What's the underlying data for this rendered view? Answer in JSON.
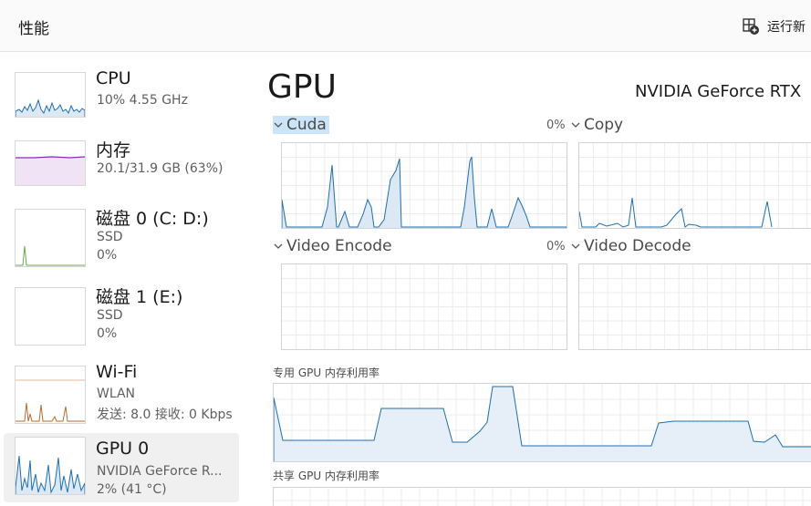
{
  "header": {
    "title": "性能",
    "run_task_label": "运行新"
  },
  "sidebar": {
    "items": [
      {
        "name": "CPU",
        "line1": "10% 4.55 GHz",
        "line2": ""
      },
      {
        "name": "内存",
        "line1": "20.1/31.9 GB (63%)",
        "line2": ""
      },
      {
        "name": "磁盘 0 (C: D:)",
        "line1": "SSD",
        "line2": "0%"
      },
      {
        "name": "磁盘 1 (E:)",
        "line1": "SSD",
        "line2": "0%"
      },
      {
        "name": "Wi-Fi",
        "line1": "WLAN",
        "line2": "发送: 8.0 接收: 0 Kbps"
      },
      {
        "name": "GPU 0",
        "line1": "NVIDIA GeForce R...",
        "line2": "2% (41 °C)"
      }
    ]
  },
  "main": {
    "title": "GPU",
    "model": "NVIDIA GeForce RTX",
    "engines": [
      {
        "label": "Cuda",
        "percent": "0%"
      },
      {
        "label": "Copy",
        "percent": ""
      },
      {
        "label": "Video Encode",
        "percent": "0%"
      },
      {
        "label": "Video Decode",
        "percent": ""
      }
    ],
    "dedicated_memory_label": "专用 GPU 内存利用率",
    "shared_memory_label": "共享 GPU 内存利用率"
  },
  "colors": {
    "gpu": "#1f6fae",
    "cpu": "#1f6fae",
    "memory": "#8b2bb0",
    "disk": "#6aa84f",
    "wifi": "#b86a2b"
  },
  "icons": {
    "run_task": "new-task-icon",
    "chevron": "chevron-down-icon"
  }
}
